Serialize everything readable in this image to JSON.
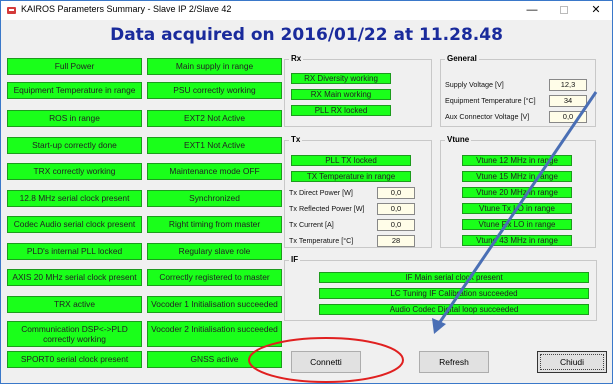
{
  "window": {
    "title": "KAIROS Parameters Summary - Slave IP 2/Slave 42",
    "minimize": "—",
    "close": "✕"
  },
  "headline": "Data acquired on 2016/01/22 at 11.28.48",
  "left_status": [
    "Full Power",
    "Equipment Temperature in range",
    "ROS in range",
    "Start-up correctly done",
    "TRX correctly working",
    "12.8 MHz serial clock present",
    "Codec Audio serial clock present",
    "PLD's internal PLL  locked",
    "AXIS 20 MHz serial clock present",
    "TRX active",
    "Communication DSP<->PLD correctly working",
    "SPORT0 serial clock present"
  ],
  "mid_status": [
    "Main supply in range",
    "PSU correctly working",
    "EXT2 Not Active",
    "EXT1 Not Active",
    "Maintenance mode OFF",
    "Synchronized",
    "Right timing from master",
    "Regulary slave role",
    "Correctly registered to master",
    "Vocoder 1 Initialisation succeeded",
    "Vocoder 2 Initialisation succeeded",
    "GNSS active"
  ],
  "rx": {
    "label": "Rx",
    "items": [
      "RX Diversity working",
      "RX Main working",
      "PLL RX  locked"
    ]
  },
  "general": {
    "label": "General",
    "fields": [
      {
        "label": "Supply Voltage [V]",
        "value": "12,3"
      },
      {
        "label": "Equipment Temperature [°C]",
        "value": "34"
      },
      {
        "label": "Aux Connector Voltage [V]",
        "value": "0,0"
      }
    ]
  },
  "tx": {
    "label": "Tx",
    "items": [
      "PLL TX  locked",
      "TX Temperature in range"
    ],
    "fields": [
      {
        "label": "Tx Direct Power [W]",
        "value": "0,0"
      },
      {
        "label": "Tx Reflected Power [W]",
        "value": "0,0"
      },
      {
        "label": "Tx Current [A]",
        "value": "0,0"
      },
      {
        "label": "Tx Temperature [°C]",
        "value": "28"
      }
    ]
  },
  "vtune": {
    "label": "Vtune",
    "items": [
      "Vtune 12 MHz in range",
      "Vtune 15 MHz in range",
      "Vtune 20 MHz in range",
      "Vtune Tx LO  in range",
      "Vtune Rx LO  in range",
      "Vtune 43 MHz in range"
    ]
  },
  "if": {
    "label": "IF",
    "items": [
      "IF Main serial clock present",
      "LC Tuning IF Calibration succeeded",
      "Audio Codec Digital loop succeeded"
    ]
  },
  "buttons": {
    "connetti": "Connetti",
    "refresh": "Refresh",
    "chiudi": "Chiudi"
  },
  "colors": {
    "status_green": "#1aff1a",
    "headline_blue": "#1a2b9c",
    "annotation_red": "#e02020",
    "annotation_arrow": "#4a6fb5"
  }
}
